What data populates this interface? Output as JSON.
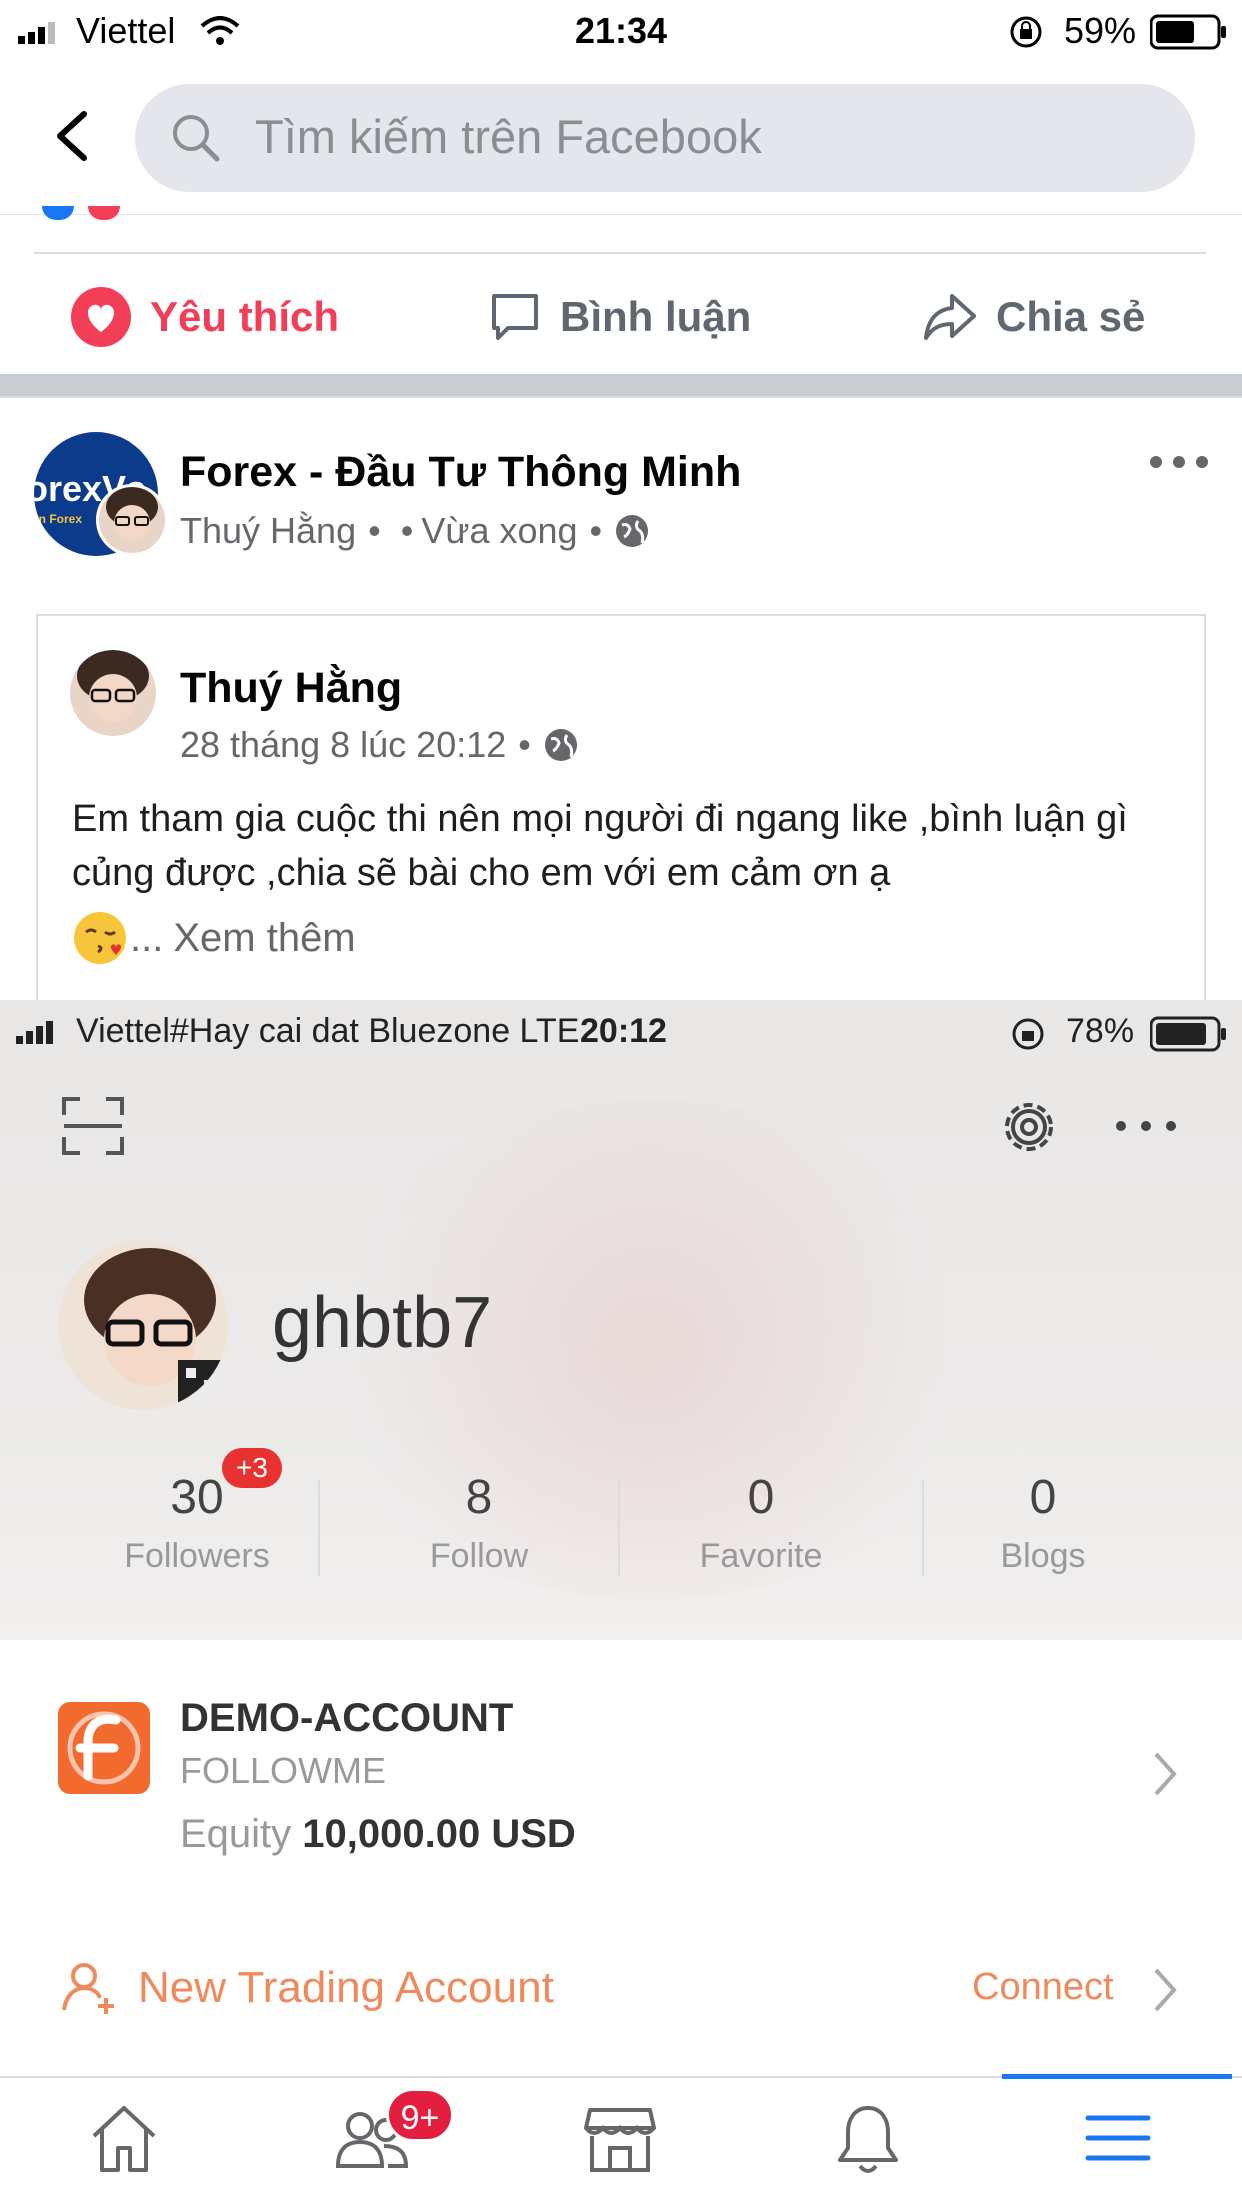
{
  "status_bar": {
    "carrier": "Viettel",
    "time": "21:34",
    "battery": "59%"
  },
  "header": {
    "search_placeholder": "Tìm kiếm trên Facebook"
  },
  "actions": {
    "like": "Yêu thích",
    "comment": "Bình luận",
    "share": "Chia sẻ"
  },
  "post": {
    "page_name": "Forex - Đầu Tư Thông Minh",
    "page_logo_text": "orexVs",
    "page_logo_sub": "ân Forex",
    "author": "Thuý Hằng",
    "dot": "•",
    "time": "Vừa xong",
    "shared": {
      "author": "Thuý Hằng",
      "date": "28 tháng 8 lúc 20:12",
      "text": "Em tham gia cuộc thi nên mọi người đi ngang like ,bình luận gì củng được ,chia sẽ bài cho em với em cảm ơn ạ",
      "ellipsis": "...",
      "see_more": "Xem thêm"
    }
  },
  "embedded": {
    "status_bar": {
      "carrier": "Viettel#Hay cai dat Bluezone  LTE",
      "time": "20:12",
      "battery": "78%"
    },
    "username": "ghbtb7",
    "stats": [
      {
        "value": "30",
        "label": "Followers"
      },
      {
        "value": "8",
        "label": "Follow"
      },
      {
        "value": "0",
        "label": "Favorite"
      },
      {
        "value": "0",
        "label": "Blogs"
      }
    ],
    "followers_badge": "+3",
    "account": {
      "title": "DEMO-ACCOUNT",
      "subtitle": "FOLLOWME",
      "equity_label": "Equity",
      "equity_value": "10,000.00 USD"
    },
    "new_account": "New Trading Account",
    "connect": "Connect"
  },
  "nav": {
    "friends_badge": "9+",
    "active_tab": "menu"
  },
  "colors": {
    "like": "#f33e58",
    "brand_blue": "#1877f2",
    "orange": "#f36a2e"
  }
}
